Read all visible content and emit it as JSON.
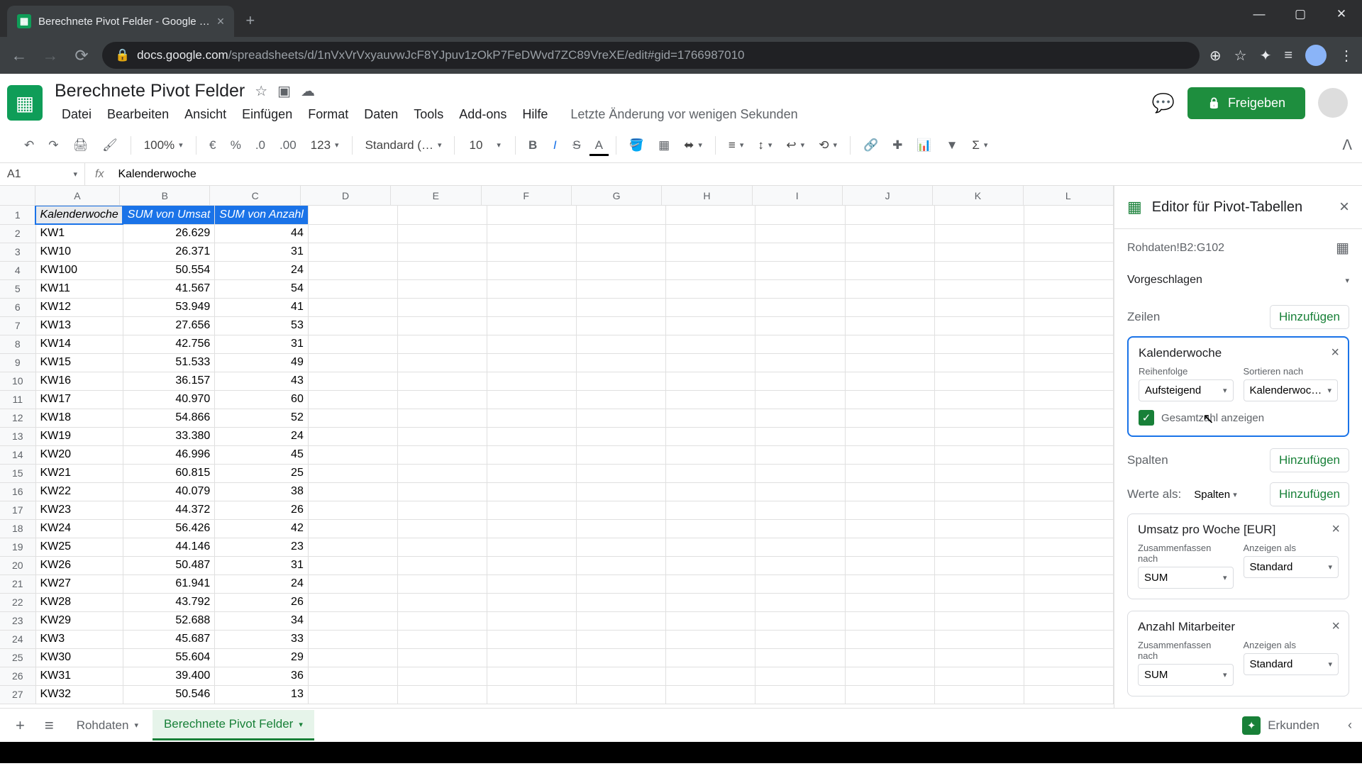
{
  "browser": {
    "tab_title": "Berechnete Pivot Felder - Google …",
    "url_host": "docs.google.com",
    "url_path": "/spreadsheets/d/1nVxVrVxyauvwJcF8YJpuv1zOkP7FeDWvd7ZC89VreXE/edit#gid=1766987010"
  },
  "doc": {
    "title": "Berechnete Pivot Felder",
    "menu": [
      "Datei",
      "Bearbeiten",
      "Ansicht",
      "Einfügen",
      "Format",
      "Daten",
      "Tools",
      "Add-ons",
      "Hilfe"
    ],
    "last_edit": "Letzte Änderung vor wenigen Sekunden",
    "share": "Freigeben"
  },
  "toolbar": {
    "zoom": "100%",
    "currency": "€",
    "pct": "%",
    "dec_dec": ".0",
    "dec_inc": ".00",
    "fmt": "123",
    "font": "Standard (…",
    "size": "10"
  },
  "fx": {
    "name_box": "A1",
    "value": "Kalenderwoche"
  },
  "columns": [
    "A",
    "B",
    "C",
    "D",
    "E",
    "F",
    "G",
    "H",
    "I",
    "J",
    "K",
    "L"
  ],
  "headers": {
    "a": "Kalenderwoche",
    "b": "SUM von Umsat",
    "c": "SUM von Anzahl"
  },
  "rows": [
    {
      "n": 1,
      "a": "KW1",
      "b": "26.629",
      "c": "44"
    },
    {
      "n": 2,
      "a": "KW10",
      "b": "26.371",
      "c": "31"
    },
    {
      "n": 3,
      "a": "KW100",
      "b": "50.554",
      "c": "24"
    },
    {
      "n": 4,
      "a": "KW11",
      "b": "41.567",
      "c": "54"
    },
    {
      "n": 5,
      "a": "KW12",
      "b": "53.949",
      "c": "41"
    },
    {
      "n": 6,
      "a": "KW13",
      "b": "27.656",
      "c": "53"
    },
    {
      "n": 7,
      "a": "KW14",
      "b": "42.756",
      "c": "31"
    },
    {
      "n": 8,
      "a": "KW15",
      "b": "51.533",
      "c": "49"
    },
    {
      "n": 9,
      "a": "KW16",
      "b": "36.157",
      "c": "43"
    },
    {
      "n": 10,
      "a": "KW17",
      "b": "40.970",
      "c": "60"
    },
    {
      "n": 11,
      "a": "KW18",
      "b": "54.866",
      "c": "52"
    },
    {
      "n": 12,
      "a": "KW19",
      "b": "33.380",
      "c": "24"
    },
    {
      "n": 13,
      "a": "KW20",
      "b": "46.996",
      "c": "45"
    },
    {
      "n": 14,
      "a": "KW21",
      "b": "60.815",
      "c": "25"
    },
    {
      "n": 15,
      "a": "KW22",
      "b": "40.079",
      "c": "38"
    },
    {
      "n": 16,
      "a": "KW23",
      "b": "44.372",
      "c": "26"
    },
    {
      "n": 17,
      "a": "KW24",
      "b": "56.426",
      "c": "42"
    },
    {
      "n": 18,
      "a": "KW25",
      "b": "44.146",
      "c": "23"
    },
    {
      "n": 19,
      "a": "KW26",
      "b": "50.487",
      "c": "31"
    },
    {
      "n": 20,
      "a": "KW27",
      "b": "61.941",
      "c": "24"
    },
    {
      "n": 21,
      "a": "KW28",
      "b": "43.792",
      "c": "26"
    },
    {
      "n": 22,
      "a": "KW29",
      "b": "52.688",
      "c": "34"
    },
    {
      "n": 23,
      "a": "KW3",
      "b": "45.687",
      "c": "33"
    },
    {
      "n": 24,
      "a": "KW30",
      "b": "55.604",
      "c": "29"
    },
    {
      "n": 25,
      "a": "KW31",
      "b": "39.400",
      "c": "36"
    },
    {
      "n": 26,
      "a": "KW32",
      "b": "50.546",
      "c": "13"
    }
  ],
  "side": {
    "title": "Editor für Pivot-Tabellen",
    "source": "Rohdaten!B2:G102",
    "suggested": "Vorgeschlagen",
    "rows_lbl": "Zeilen",
    "cols_lbl": "Spalten",
    "add": "Hinzufügen",
    "row_card": {
      "title": "Kalenderwoche",
      "order_lbl": "Reihenfolge",
      "order": "Aufsteigend",
      "sort_lbl": "Sortieren nach",
      "sort": "Kalenderwoc…",
      "totals": "Gesamtzahl anzeigen"
    },
    "values_lbl": "Werte als:",
    "values_as": "Spalten",
    "val1": {
      "title": "Umsatz pro Woche [EUR]",
      "sum_lbl": "Zusammenfassen nach",
      "sum": "SUM",
      "show_lbl": "Anzeigen als",
      "show": "Standard"
    },
    "val2": {
      "title": "Anzahl Mitarbeiter",
      "sum_lbl": "Zusammenfassen nach",
      "sum": "SUM",
      "show_lbl": "Anzeigen als",
      "show": "Standard"
    }
  },
  "tabs": {
    "t1": "Rohdaten",
    "t2": "Berechnete Pivot Felder",
    "explore": "Erkunden"
  }
}
